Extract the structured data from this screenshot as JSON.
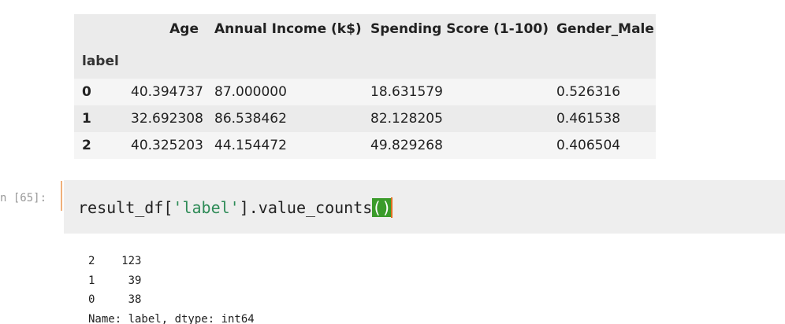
{
  "dataframe": {
    "columns": [
      "",
      "Age",
      "Annual Income (k$)",
      "Spending Score (1-100)",
      "Gender_Male"
    ],
    "index_name": "label",
    "rows": [
      {
        "index": "0",
        "age": "40.394737",
        "income": "87.000000",
        "score": "18.631579",
        "gender_male": "0.526316"
      },
      {
        "index": "1",
        "age": "32.692308",
        "income": "86.538462",
        "score": "82.128205",
        "gender_male": "0.461538"
      },
      {
        "index": "2",
        "age": "40.325203",
        "income": "44.154472",
        "score": "49.829268",
        "gender_male": "0.406504"
      }
    ]
  },
  "cell": {
    "prompt": "n [65]:",
    "code_prefix": "result_df[",
    "code_string": "'label'",
    "code_middle": "].value_counts",
    "code_paren": "()"
  },
  "output": {
    "lines": [
      "2    123",
      "1     39",
      "0     38",
      "Name: label, dtype: int64"
    ]
  }
}
